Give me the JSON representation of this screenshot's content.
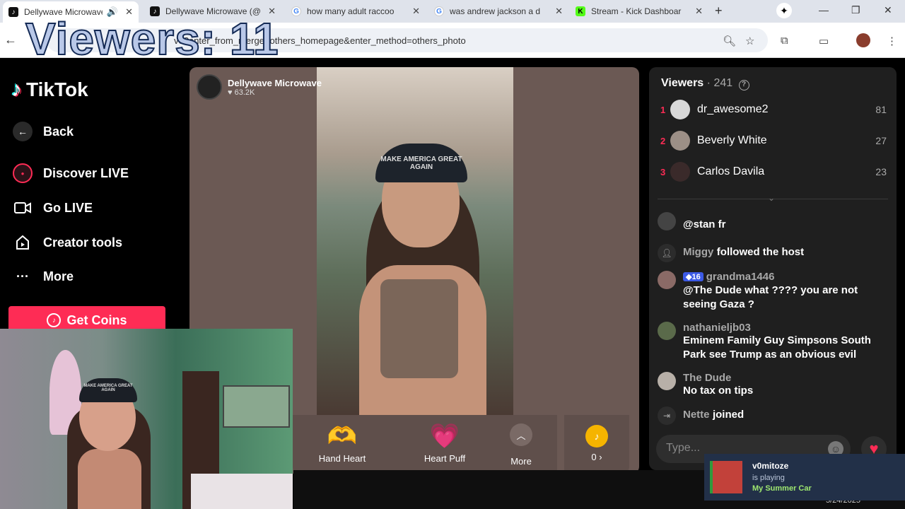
{
  "overlay": {
    "viewers": "Viewers: 11"
  },
  "browser": {
    "tabs": [
      {
        "title": "Dellywave Microwave",
        "icon": "tiktok-icon",
        "audio": true
      },
      {
        "title": "Dellywave Microwave (@",
        "icon": "tiktok-icon"
      },
      {
        "title": "how many adult raccoo",
        "icon": "google-icon"
      },
      {
        "title": "was andrew jackson a d",
        "icon": "google-icon"
      },
      {
        "title": "Stream - Kick Dashboar",
        "icon": "kick-icon"
      }
    ],
    "url_fragment": "ve?enter_from_merge=others_homepage&enter_method=others_photo"
  },
  "sidebar": {
    "logo": "TikTok",
    "items": [
      {
        "label": "Back"
      },
      {
        "label": "Discover LIVE"
      },
      {
        "label": "Go LIVE"
      },
      {
        "label": "Creator tools"
      },
      {
        "label": "More"
      }
    ],
    "get_coins": "Get Coins"
  },
  "stream": {
    "host_name": "Dellywave Microwave",
    "likes": "63.2K",
    "hat_text": "MAKE AMERICA GREAT AGAIN",
    "gifts": [
      {
        "label": "Hand Heart"
      },
      {
        "label": "Heart Puff"
      }
    ],
    "more_label": "More",
    "coin_count": "0"
  },
  "viewers_panel": {
    "title": "Viewers",
    "count": "241",
    "top": [
      {
        "rank": "1",
        "name": "dr_awesome2",
        "score": "81"
      },
      {
        "rank": "2",
        "name": "Beverly White",
        "score": "27"
      },
      {
        "rank": "3",
        "name": "Carlos Davila",
        "score": "23"
      }
    ]
  },
  "chat": {
    "messages": [
      {
        "text": "@stan fr"
      },
      {
        "user": "Miggy",
        "text": "followed the host"
      },
      {
        "badge": "16",
        "user": "grandma1446",
        "text": "@The Dude what ???? you are not seeing Gaza ?"
      },
      {
        "user": "nathanieljb03",
        "text": "Eminem Family Guy Simpsons South Park see Trump as an obvious evil"
      },
      {
        "user": "The Dude",
        "text": "No tax on tips"
      },
      {
        "user": "Nette",
        "text": "joined"
      }
    ],
    "input_placeholder": "Type..."
  },
  "now_playing": {
    "user": "v0mitoze",
    "status": "is playing",
    "game": "My Summer Car"
  },
  "date_fragment": "5/24/2025"
}
